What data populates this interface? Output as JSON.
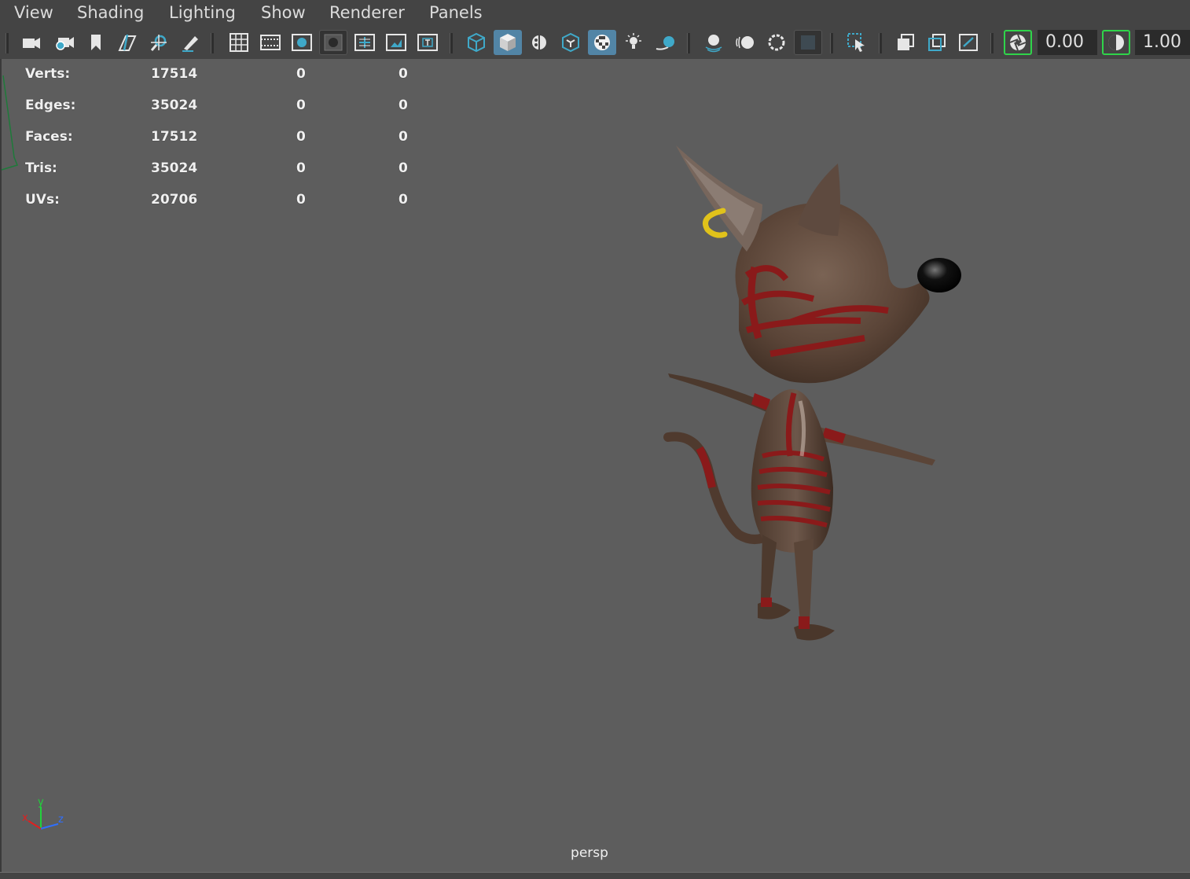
{
  "menubar": {
    "items": [
      "View",
      "Shading",
      "Lighting",
      "Show",
      "Renderer",
      "Panels"
    ]
  },
  "toolbar": {
    "icons": [
      "select-camera-icon",
      "camera-attributes-icon",
      "bookmark-icon",
      "image-plane-icon",
      "2d-pan-zoom-icon",
      "grease-pencil-icon",
      "grid-icon",
      "film-gate-icon",
      "resolution-gate-icon",
      "gate-mask-icon",
      "field-chart-icon",
      "safe-action-icon",
      "safe-title-icon",
      "wireframe-icon",
      "smooth-shade-all-icon",
      "wireframe-on-shaded-icon",
      "xray-icon",
      "textured-icon",
      "use-all-lights-icon",
      "shadows-icon",
      "screen-space-ao-icon",
      "motion-blur-icon",
      "multisample-aa-icon",
      "depth-of-field-icon",
      "isolate-select-icon",
      "xray-active-components-icon",
      "xray-joints-icon",
      "xray-display-icon",
      "exposure-icon",
      "gamma-icon"
    ],
    "exposure_value": "0.00",
    "gamma_value": "1.00",
    "accent_color": "#5285a6",
    "highlight_bracket_color": "#2fd44a"
  },
  "hud": {
    "rows": [
      {
        "label": "Verts:",
        "v1": "17514",
        "v2": "0",
        "v3": "0"
      },
      {
        "label": "Edges:",
        "v1": "35024",
        "v2": "0",
        "v3": "0"
      },
      {
        "label": "Faces:",
        "v1": "17512",
        "v2": "0",
        "v3": "0"
      },
      {
        "label": "Tris:",
        "v1": "35024",
        "v2": "0",
        "v3": "0"
      },
      {
        "label": "UVs:",
        "v1": "20706",
        "v2": "0",
        "v3": "0"
      }
    ]
  },
  "viewport": {
    "camera_label": "persp",
    "background_color": "#5d5d5d",
    "axis": {
      "x": "x",
      "y": "y",
      "z": "z"
    }
  }
}
